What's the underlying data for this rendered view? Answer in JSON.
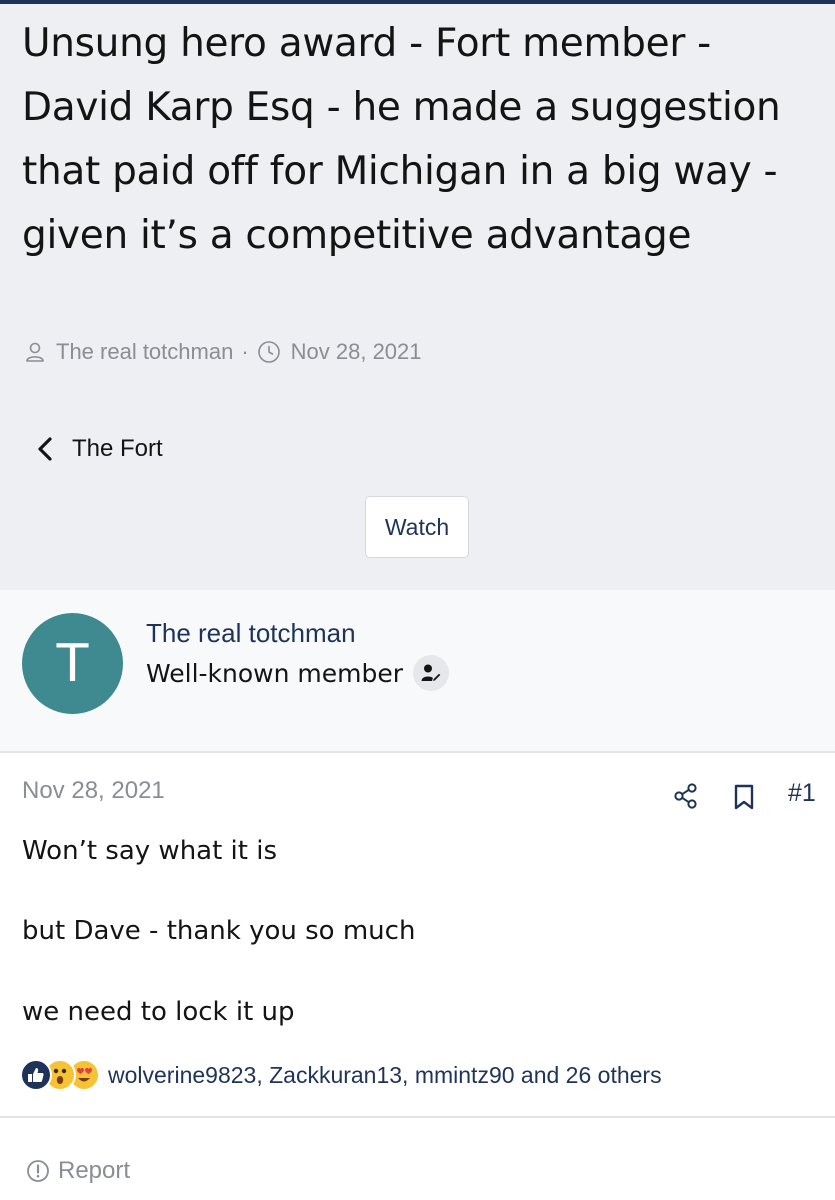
{
  "thread": {
    "title": "Unsung hero award - Fort member - David Karp Esq - he made a suggestion that paid off for Michigan in a big way - given it’s a competitive advantage",
    "author": "The real totchman",
    "separator": "·",
    "date": "Nov 28, 2021"
  },
  "breadcrumb": {
    "label": "The Fort"
  },
  "actions": {
    "watch_label": "Watch"
  },
  "user": {
    "avatar_letter": "T",
    "name": "The real totchman",
    "title": "Well-known member"
  },
  "post": {
    "date": "Nov 28, 2021",
    "number": "#1",
    "lines": [
      "Won’t say what it is",
      "but Dave - thank you so much",
      "we need to lock it up"
    ],
    "reactions_text": "wolverine9823, Zackkuran13, mmintz90 and 26 others"
  },
  "footer": {
    "report_label": "Report"
  },
  "icons": {
    "author": "user-icon",
    "date": "clock-icon",
    "back": "chevron-left-icon",
    "badge": "user-edit-icon",
    "share": "share-icon",
    "bookmark": "bookmark-icon",
    "reactions": [
      "like-icon",
      "wow-icon",
      "love-icon"
    ],
    "report": "alert-circle-icon"
  },
  "colors": {
    "header_bg": "#eeeff2",
    "accent": "#1f3358",
    "avatar_bg": "#3f8a91",
    "muted_text": "#8a8d93",
    "reaction_yellow": "#f6c334"
  }
}
